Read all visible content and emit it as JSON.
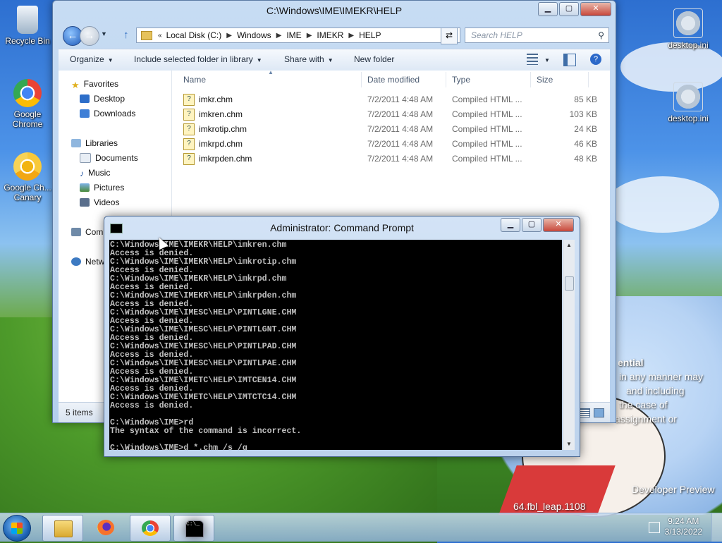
{
  "desktop": {
    "icons": [
      {
        "label": "Recycle Bin"
      },
      {
        "label": "Google Chrome"
      },
      {
        "label": "Google Ch... Canary"
      },
      {
        "label": "desktop.ini"
      },
      {
        "label": "desktop.ini"
      }
    ],
    "overlay_lines": [
      "ential",
      "in any manner may",
      "and including",
      "the case of",
      "assignment or",
      "Developer Preview",
      "64.fbl_leap.1108"
    ]
  },
  "explorer": {
    "title": "C:\\Windows\\IME\\IMEKR\\HELP",
    "breadcrumb": [
      "Local Disk (C:)",
      "Windows",
      "IME",
      "IMEKR",
      "HELP"
    ],
    "search_placeholder": "Search HELP",
    "toolbar": {
      "organize": "Organize",
      "include": "Include selected folder in library",
      "share": "Share with",
      "new_folder": "New folder"
    },
    "nav": {
      "favorites": "Favorites",
      "desktop": "Desktop",
      "downloads": "Downloads",
      "libraries": "Libraries",
      "documents": "Documents",
      "music": "Music",
      "pictures": "Pictures",
      "videos": "Videos",
      "computer": "Comp",
      "network": "Netw"
    },
    "columns": {
      "name": "Name",
      "date": "Date modified",
      "type": "Type",
      "size": "Size"
    },
    "files": [
      {
        "name": "imkr.chm",
        "date": "7/2/2011 4:48 AM",
        "type": "Compiled HTML ...",
        "size": "85 KB"
      },
      {
        "name": "imkren.chm",
        "date": "7/2/2011 4:48 AM",
        "type": "Compiled HTML ...",
        "size": "103 KB"
      },
      {
        "name": "imkrotip.chm",
        "date": "7/2/2011 4:48 AM",
        "type": "Compiled HTML ...",
        "size": "24 KB"
      },
      {
        "name": "imkrpd.chm",
        "date": "7/2/2011 4:48 AM",
        "type": "Compiled HTML ...",
        "size": "46 KB"
      },
      {
        "name": "imkrpden.chm",
        "date": "7/2/2011 4:48 AM",
        "type": "Compiled HTML ...",
        "size": "48 KB"
      }
    ],
    "status": "5 items"
  },
  "cmd": {
    "title": "Administrator: Command Prompt",
    "lines": [
      "C:\\Windows\\IME\\IMEKR\\HELP\\imkren.chm",
      "Access is denied.",
      "C:\\Windows\\IME\\IMEKR\\HELP\\imkrotip.chm",
      "Access is denied.",
      "C:\\Windows\\IME\\IMEKR\\HELP\\imkrpd.chm",
      "Access is denied.",
      "C:\\Windows\\IME\\IMEKR\\HELP\\imkrpden.chm",
      "Access is denied.",
      "C:\\Windows\\IME\\IMESC\\HELP\\PINTLGNE.CHM",
      "Access is denied.",
      "C:\\Windows\\IME\\IMESC\\HELP\\PINTLGNT.CHM",
      "Access is denied.",
      "C:\\Windows\\IME\\IMESC\\HELP\\PINTLPAD.CHM",
      "Access is denied.",
      "C:\\Windows\\IME\\IMESC\\HELP\\PINTLPAE.CHM",
      "Access is denied.",
      "C:\\Windows\\IME\\IMETC\\HELP\\IMTCEN14.CHM",
      "Access is denied.",
      "C:\\Windows\\IME\\IMETC\\HELP\\IMTCTC14.CHM",
      "Access is denied.",
      "",
      "C:\\Windows\\IME>rd",
      "The syntax of the command is incorrect.",
      "",
      "C:\\Windows\\IME>d *.chm /s /q"
    ]
  },
  "taskbar": {
    "time": "9:24 AM",
    "date": "3/13/2022",
    "cmd_icon_text": "C:\\_"
  }
}
